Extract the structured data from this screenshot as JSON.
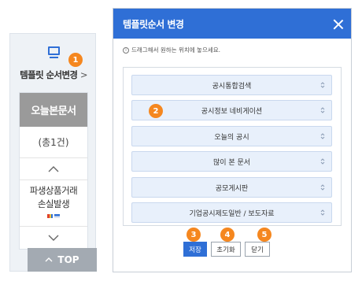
{
  "side_panel": {
    "icon": "monitor-icon",
    "title": "템플릿 순서변경",
    "chevron": ">",
    "active_tab": "오늘본문서",
    "count": "(총1건)",
    "item": {
      "line1": "파생상품거래",
      "line2": "손실발생"
    },
    "top_button": "TOP"
  },
  "badges": [
    "1",
    "2",
    "3",
    "4",
    "5"
  ],
  "modal": {
    "title": "템플릿순서 변경",
    "hint": "드래그해서 원하는 위치에 놓으세요.",
    "rows": [
      "공시통합검색",
      "공시정보 네비게이션",
      "오늘의 공시",
      "많이 본 문서",
      "공모게시판",
      "기업공시제도일반 / 보도자료"
    ],
    "buttons": {
      "save": "저장",
      "reset": "초기화",
      "close": "닫기"
    }
  },
  "colors": {
    "accent": "#2f6fd6",
    "badge": "#f5871f",
    "active_tab": "#9a9a9a",
    "row_bg": "#e8f0fb"
  }
}
